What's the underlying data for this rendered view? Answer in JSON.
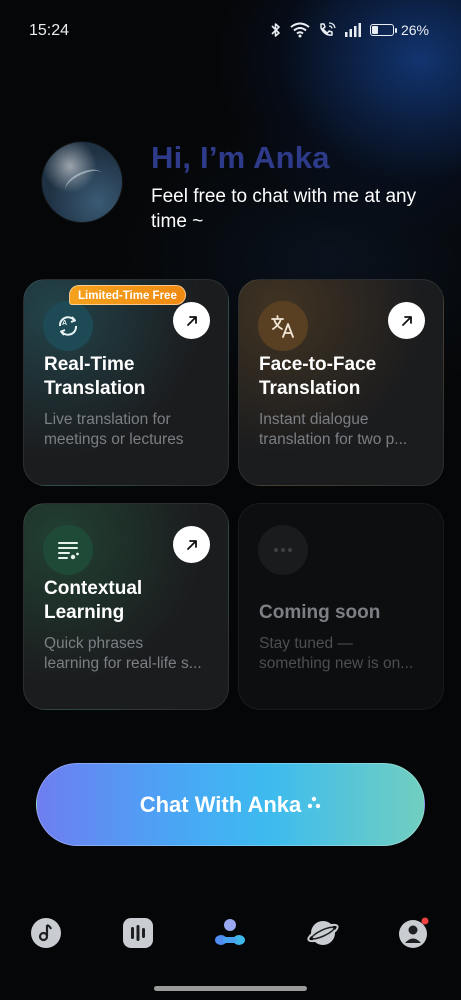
{
  "status_bar": {
    "time": "15:24",
    "battery_percent": "26%",
    "battery_level": 0.26,
    "icons": [
      "bluetooth-icon",
      "wifi-icon",
      "wifi-calling-icon",
      "signal-icon",
      "battery-icon"
    ]
  },
  "greeting": {
    "title": "Hi, I’m Anka",
    "subtitle": "Feel free to chat with me at any time ~"
  },
  "cards": [
    {
      "badge": "Limited-Time Free",
      "title": "Real-Time Translation",
      "title_lines": [
        "Real-Time",
        "Translation"
      ],
      "desc_lines": [
        "Live translation for",
        "meetings or lectures"
      ],
      "icon": "sync-translate-icon"
    },
    {
      "title": "Face-to-Face Translation",
      "title_lines": [
        "Face-to-Face",
        "Translation"
      ],
      "desc_lines": [
        "Instant dialogue",
        "translation for two p..."
      ],
      "icon": "language-translate-icon"
    },
    {
      "title": "Contextual Learning",
      "title_lines": [
        "Contextual",
        "Learning"
      ],
      "desc_lines": [
        "Quick phrases",
        "learning for real-life s..."
      ],
      "icon": "notes-list-icon"
    },
    {
      "title": "Coming soon",
      "desc_lines": [
        "Stay tuned —",
        "something new is on..."
      ],
      "icon": "more-dots-icon"
    }
  ],
  "cta": {
    "label": "Chat With Anka"
  },
  "bottom_nav": [
    {
      "name": "music",
      "icon": "music-note-icon"
    },
    {
      "name": "podcast",
      "icon": "audio-bars-icon"
    },
    {
      "name": "anka",
      "icon": "anka-assistant-icon",
      "active": true
    },
    {
      "name": "explore",
      "icon": "planet-icon"
    },
    {
      "name": "profile",
      "icon": "profile-icon",
      "has_notification": true
    }
  ],
  "colors": {
    "background": "#050607",
    "greeting_title": "#2e3a8a",
    "badge": "#f08a12",
    "cta_gradient": [
      "#6e7ef0",
      "#3dbbef",
      "#71cfc0"
    ],
    "notification_dot": "#ef4040"
  }
}
